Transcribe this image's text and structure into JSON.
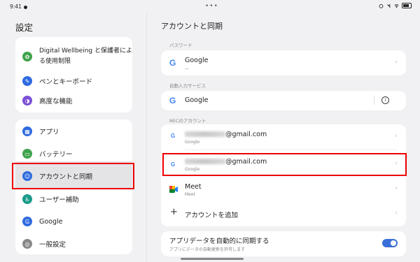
{
  "status": {
    "time": "9:41",
    "handle": "•••"
  },
  "left": {
    "title": "設定",
    "group1": [
      {
        "label": "Digital Wellbeing と保護者による使用制限",
        "icon": "digital-wellbeing-icon",
        "color": "#3fa34d"
      },
      {
        "label": "ペンとキーボード",
        "icon": "pen-icon",
        "color": "#2f6be0"
      },
      {
        "label": "高度な機能",
        "icon": "advanced-icon",
        "color": "#7b4fd6"
      }
    ],
    "group2": [
      {
        "label": "アプリ",
        "icon": "apps-icon",
        "color": "#2f6be0"
      },
      {
        "label": "バッテリー",
        "icon": "battery-icon",
        "color": "#3fa34d"
      },
      {
        "label": "アカウントと同期",
        "icon": "account-icon",
        "color": "#2f6be0"
      },
      {
        "label": "ユーザー補助",
        "icon": "accessibility-icon",
        "color": "#1a9b8a"
      },
      {
        "label": "Google",
        "icon": "google-icon",
        "color": "#2f6be0"
      },
      {
        "label": "一般設定",
        "icon": "general-settings-icon",
        "color": "#888888"
      }
    ]
  },
  "right": {
    "title": "アカウントと同期",
    "password_label": "パスワード",
    "password_item": {
      "title": "Google",
      "sub": "—"
    },
    "autofill_label": "自動入力サービス",
    "autofill_item": {
      "title": "Google"
    },
    "nec_label": "NECのアカウント",
    "accounts": [
      {
        "email": "@gmail.com",
        "sub": "Google"
      },
      {
        "email": "@gmail.com",
        "sub": "Google"
      },
      {
        "title": "Meet",
        "sub": "Meet"
      }
    ],
    "add_account": "アカウントを追加",
    "sync": {
      "title": "アプリデータを自動的に同期する",
      "sub": "アプリにデータの自動更新を許可します"
    }
  }
}
